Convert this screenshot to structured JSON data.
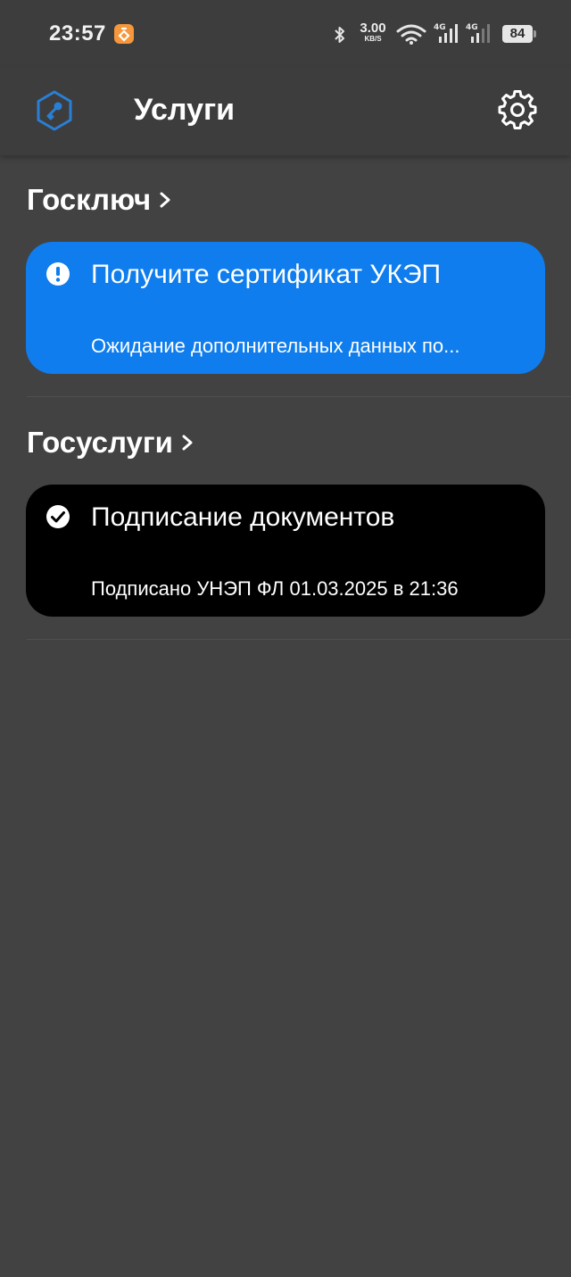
{
  "status_bar": {
    "time": "23:57",
    "net_speed_value": "3.00",
    "net_speed_unit": "KB/S",
    "battery": "84",
    "icons": [
      "bluetooth-icon",
      "wifi-icon",
      "signal-4g-icon",
      "signal-4g-icon"
    ]
  },
  "app_bar": {
    "title": "Услуги",
    "logo_icon": "key-shield-icon",
    "settings_icon": "gear-icon"
  },
  "sections": [
    {
      "title": "Госключ",
      "card": {
        "icon": "exclamation-circle-icon",
        "title": "Получите сертификат УКЭП",
        "subtitle": "Ожидание дополнительных данных по..."
      }
    },
    {
      "title": "Госуслуги",
      "card": {
        "icon": "check-circle-icon",
        "title": "Подписание документов",
        "subtitle": "Подписано УНЭП ФЛ 01.03.2025 в 21:36"
      }
    }
  ],
  "colors": {
    "background": "#424242",
    "bar": "#3d3d3d",
    "accent_blue": "#0f7ded",
    "logo_blue": "#2a7fd4",
    "card_black": "#000000"
  }
}
